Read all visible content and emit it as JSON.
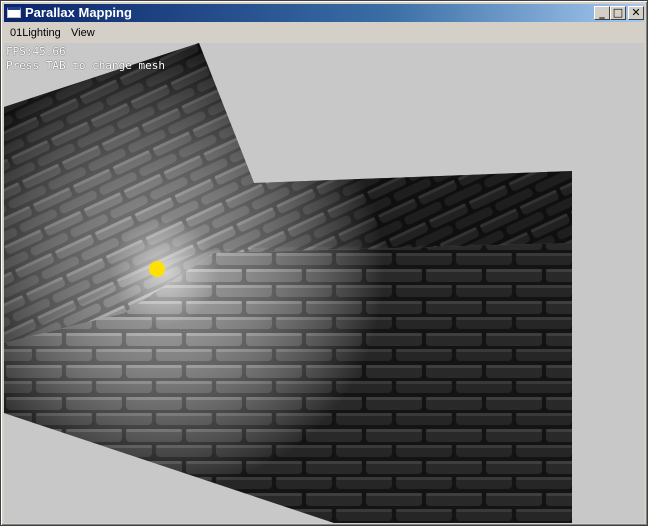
{
  "window": {
    "title": "Parallax Mapping",
    "controls": {
      "minimize": "_",
      "maximize": "□",
      "close": "✕"
    }
  },
  "menu": {
    "items": [
      "01Lighting",
      "View"
    ]
  },
  "hud": {
    "fps": "FPS:45.66",
    "hint": "Press TAB to change mesh"
  },
  "colors": {
    "light": "#ffe000",
    "background": "#c8c8c8",
    "stone": "#3a3a3a"
  }
}
